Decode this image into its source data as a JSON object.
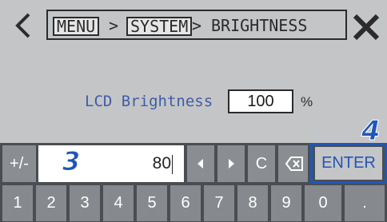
{
  "header": {
    "breadcrumb": [
      "MENU",
      "SYSTEM",
      "BRIGHTNESS"
    ],
    "separator": ">"
  },
  "main": {
    "label": "LCD Brightness",
    "value": "100",
    "unit": "%"
  },
  "callouts": {
    "input": "3",
    "enter": "4"
  },
  "keypad": {
    "sign_label": "+/-",
    "input_value": "80",
    "clear_label": "C",
    "enter_label": "ENTER",
    "digits": [
      "1",
      "2",
      "3",
      "4",
      "5",
      "6",
      "7",
      "8",
      "9",
      "0",
      "."
    ]
  },
  "colors": {
    "accent": "#1f57b8",
    "label_blue": "#3e5ca8",
    "key_gray": "#8a8d91",
    "panel_dark": "#4a4d52",
    "background": "#c4c5c7"
  },
  "icons": [
    "chevron-left-icon",
    "close-icon",
    "arrow-left-icon",
    "arrow-right-icon",
    "backspace-icon"
  ]
}
